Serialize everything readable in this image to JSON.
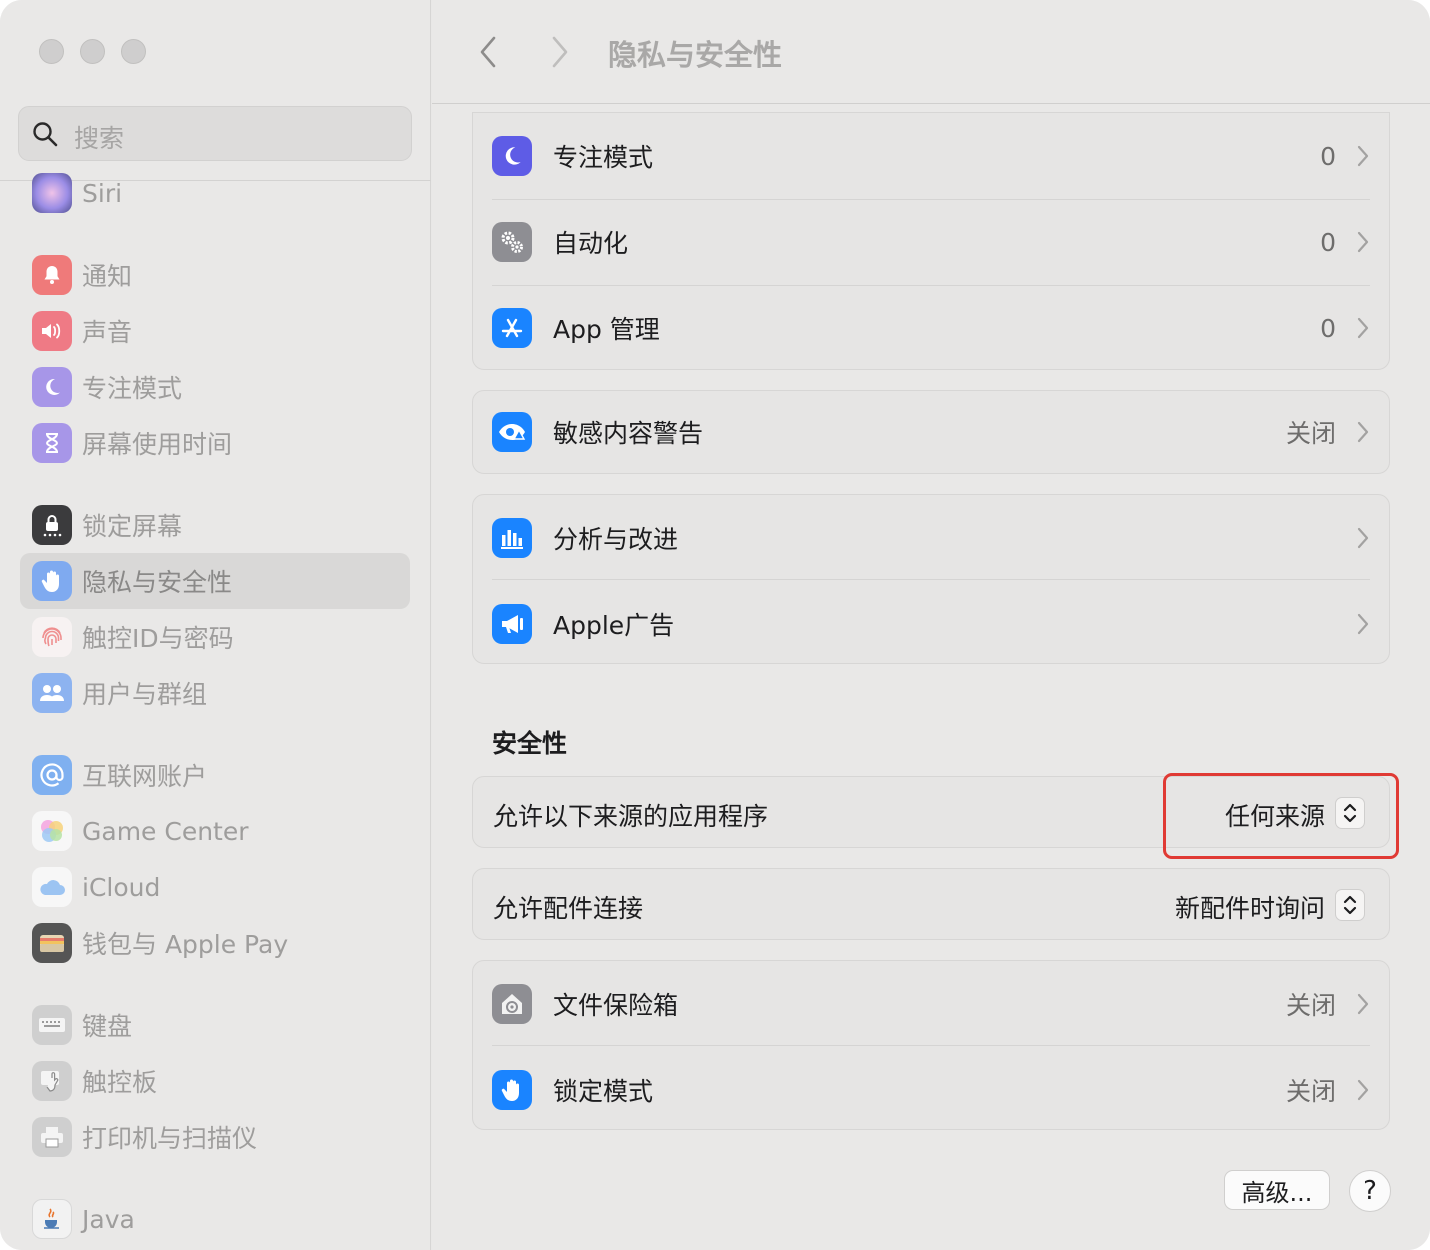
{
  "window": {
    "title": "隐私与安全性"
  },
  "search": {
    "placeholder": "搜索"
  },
  "sidebar": {
    "items": [
      {
        "label": "Siri",
        "icon": "siri-icon",
        "color": "#8e6fd6"
      },
      {
        "label": "通知",
        "icon": "bell-icon",
        "color": "#ef7a7a"
      },
      {
        "label": "声音",
        "icon": "speaker-icon",
        "color": "#ef7a85"
      },
      {
        "label": "专注模式",
        "icon": "moon-icon",
        "color": "#a796e8"
      },
      {
        "label": "屏幕使用时间",
        "icon": "hourglass-icon",
        "color": "#a796e8"
      },
      {
        "label": "锁定屏幕",
        "icon": "lock-screen-icon",
        "color": "#3b3b3d"
      },
      {
        "label": "隐私与安全性",
        "icon": "hand-icon",
        "color": "#7faaf0"
      },
      {
        "label": "触控ID与密码",
        "icon": "fingerprint-icon",
        "color": "#f0a6a6"
      },
      {
        "label": "用户与群组",
        "icon": "users-icon",
        "color": "#8db3f0"
      },
      {
        "label": "互联网账户",
        "icon": "at-icon",
        "color": "#7fb0f0"
      },
      {
        "label": "Game Center",
        "icon": "game-center-icon",
        "color": "#e58bd6"
      },
      {
        "label": "iCloud",
        "icon": "cloud-icon",
        "color": "#9cc4f2"
      },
      {
        "label": "钱包与 Apple Pay",
        "icon": "wallet-icon",
        "color": "#555555"
      },
      {
        "label": "键盘",
        "icon": "keyboard-icon",
        "color": "#bdbdbd"
      },
      {
        "label": "触控板",
        "icon": "trackpad-icon",
        "color": "#bdbdbd"
      },
      {
        "label": "打印机与扫描仪",
        "icon": "printer-icon",
        "color": "#bdbdbd"
      },
      {
        "label": "Java",
        "icon": "java-icon",
        "color": "#f2f2f2"
      }
    ]
  },
  "main": {
    "group1": [
      {
        "label": "专注模式",
        "value": "0",
        "icon": "moon-icon",
        "color": "#5e5ce6"
      },
      {
        "label": "自动化",
        "value": "0",
        "icon": "gears-icon",
        "color": "#8e8e93"
      },
      {
        "label": "App 管理",
        "value": "0",
        "icon": "app-store-icon",
        "color": "#1a84ff"
      }
    ],
    "group2": [
      {
        "label": "敏感内容警告",
        "value": "关闭",
        "icon": "eye-warning-icon",
        "color": "#1a84ff"
      }
    ],
    "group3": [
      {
        "label": "分析与改进",
        "value": "",
        "icon": "bar-chart-icon",
        "color": "#1a84ff"
      },
      {
        "label": "Apple广告",
        "value": "",
        "icon": "megaphone-icon",
        "color": "#1a84ff"
      }
    ],
    "security_heading": "安全性",
    "allow_apps": {
      "label": "允许以下来源的应用程序",
      "value": "任何来源"
    },
    "allow_accessories": {
      "label": "允许配件连接",
      "value": "新配件时询问"
    },
    "group4": [
      {
        "label": "文件保险箱",
        "value": "关闭",
        "icon": "filevault-icon",
        "color": "#8e8e93"
      },
      {
        "label": "锁定模式",
        "value": "关闭",
        "icon": "hand-icon",
        "color": "#1a84ff"
      }
    ],
    "advanced_label": "高级...",
    "help_label": "?"
  },
  "highlight_color": "#e03a34"
}
